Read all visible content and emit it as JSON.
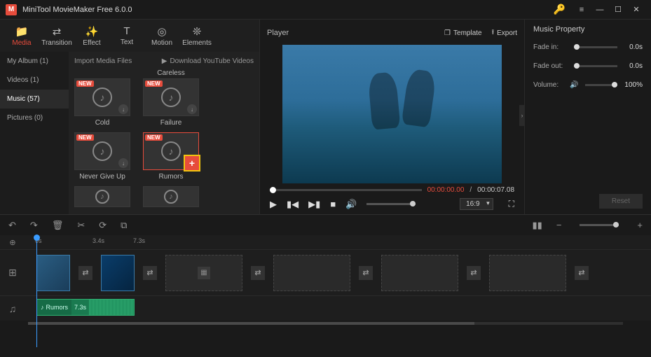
{
  "app": {
    "title": "MiniTool MovieMaker Free 6.0.0"
  },
  "tabs": {
    "media": "Media",
    "transition": "Transition",
    "effect": "Effect",
    "text": "Text",
    "motion": "Motion",
    "elements": "Elements"
  },
  "sidebar": {
    "items": [
      {
        "label": "My Album (1)"
      },
      {
        "label": "Videos (1)"
      },
      {
        "label": "Music (57)"
      },
      {
        "label": "Pictures (0)"
      }
    ]
  },
  "media": {
    "import_label": "Import Media Files",
    "download_label": "Download YouTube Videos",
    "row0": [
      {
        "name": "Careless"
      }
    ],
    "row1": [
      {
        "name": "Cold"
      },
      {
        "name": "Failure"
      }
    ],
    "row2": [
      {
        "name": "Never Give Up"
      },
      {
        "name": "Rumors"
      }
    ]
  },
  "player": {
    "title": "Player",
    "template_label": "Template",
    "export_label": "Export",
    "time_current": "00:00:00.00",
    "time_total": "00:00:07.08",
    "aspect": "16:9"
  },
  "props": {
    "title": "Music Property",
    "fade_in_label": "Fade in:",
    "fade_in_val": "0.0s",
    "fade_out_label": "Fade out:",
    "fade_out_val": "0.0s",
    "volume_label": "Volume:",
    "volume_val": "100%",
    "reset": "Reset"
  },
  "ruler": {
    "t0": "0s",
    "t1": "3.4s",
    "t2": "7.3s"
  },
  "music_clip": {
    "name": "Rumors",
    "duration": "7.3s"
  }
}
